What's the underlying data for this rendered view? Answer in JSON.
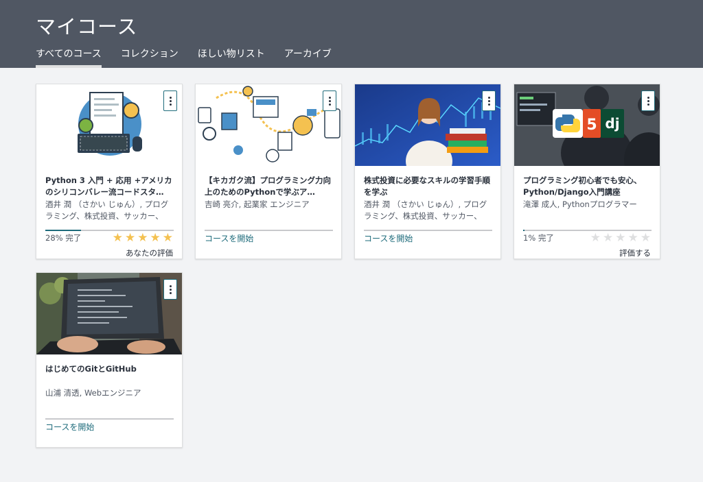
{
  "header": {
    "title": "マイコース",
    "tabs": [
      {
        "label": "すべてのコース",
        "active": true
      },
      {
        "label": "コレクション",
        "active": false
      },
      {
        "label": "ほしい物リスト",
        "active": false
      },
      {
        "label": "アーカイブ",
        "active": false
      }
    ]
  },
  "courses": [
    {
      "title": "Python 3 入門 + 応用 +アメリカのシリコンバレー流コードスタ…",
      "author": "酒井 潤 （さかい じゅん）, プログラミング、株式投資、サッカー、",
      "progress_percent": 28,
      "progress_text": "28% 完了",
      "rating": 5,
      "rating_label": "あなたの評価"
    },
    {
      "title": "【キカガク流】プログラミング力向上のためのPythonで学ぶア…",
      "author": "吉崎 亮介, 起業家 エンジニア",
      "progress_percent": 0,
      "start_label": "コースを開始"
    },
    {
      "title": "株式投資に必要なスキルの学習手順を学ぶ",
      "author": "酒井 潤 （さかい じゅん）, プログラミング、株式投資、サッカー、",
      "progress_percent": 0,
      "start_label": "コースを開始"
    },
    {
      "title": "プログラミング初心者でも安心、Python/Django入門講座",
      "author": "滝澤 成人, Pythonプログラマー",
      "progress_percent": 1,
      "progress_text": "1% 完了",
      "rating": 0,
      "rating_label": "評価する",
      "thumb_text": "dj"
    },
    {
      "title": "はじめてのGitとGitHub",
      "author": "山浦 清透, Webエンジニア",
      "progress_percent": 0,
      "start_label": "コースを開始"
    }
  ],
  "colors": {
    "header_bg": "#505763",
    "accent": "#1e6b7b",
    "star_on": "#f4c150",
    "star_off": "#dedfe0"
  }
}
